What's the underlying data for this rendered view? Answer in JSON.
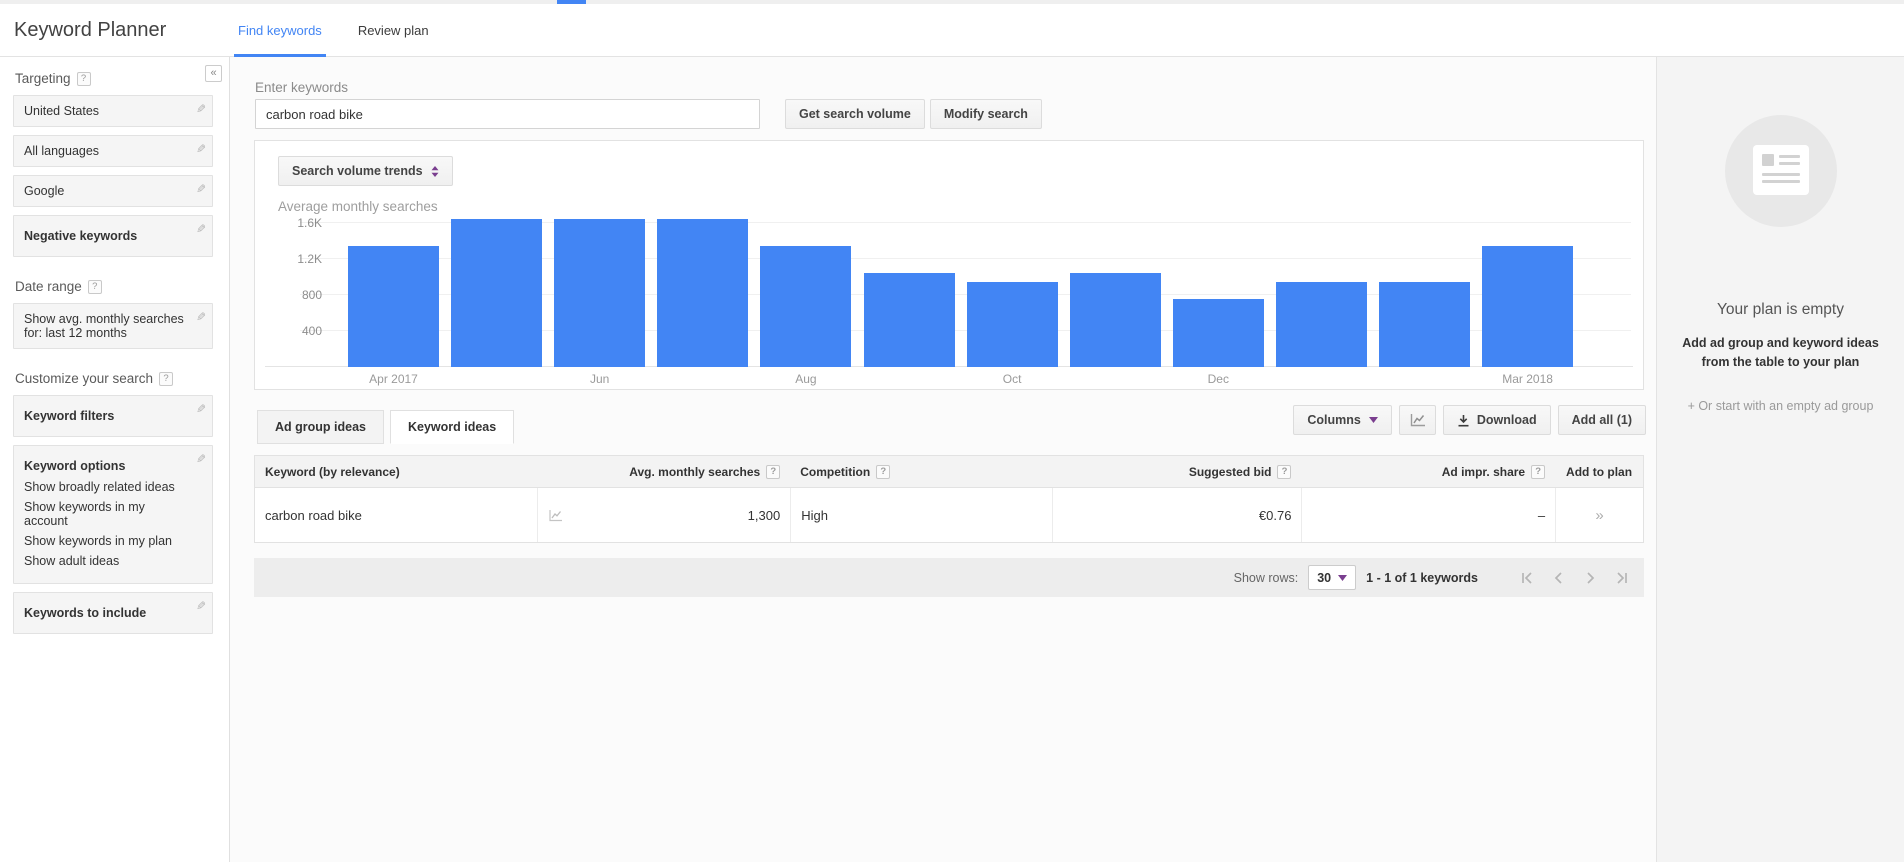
{
  "accent_color": "#4285f4",
  "header": {
    "app_title": "Keyword Planner",
    "tabs": [
      {
        "label": "Find keywords",
        "active": true
      },
      {
        "label": "Review plan",
        "active": false
      }
    ]
  },
  "sidebar": {
    "collapse_glyph": "«",
    "sections": [
      {
        "title": "Targeting",
        "help": true,
        "items": [
          {
            "label": "United States",
            "bold": false
          },
          {
            "label": "All languages",
            "bold": false
          },
          {
            "label": "Google",
            "bold": false
          },
          {
            "label": "Negative keywords",
            "bold": true
          }
        ]
      },
      {
        "title": "Date range",
        "help": true,
        "items": [
          {
            "label": "Show avg. monthly searches for: last 12 months",
            "bold": false
          }
        ]
      },
      {
        "title": "Customize your search",
        "help": true,
        "items": [
          {
            "label": "Keyword filters",
            "bold": true
          },
          {
            "label": "Keyword options",
            "bold": true,
            "sub": [
              "Show broadly related ideas",
              "Show keywords in my account",
              "Show keywords in my plan",
              "Show adult ideas"
            ]
          },
          {
            "label": "Keywords to include",
            "bold": true
          }
        ]
      }
    ]
  },
  "search": {
    "label": "Enter keywords",
    "value": "carbon road bike",
    "get_volume_label": "Get search volume",
    "modify_label": "Modify search"
  },
  "chart_data": {
    "type": "bar",
    "title": "Average monthly searches",
    "control_label": "Search volume trends",
    "categories": [
      "Apr 2017",
      "May 2017",
      "Jun 2017",
      "Jul 2017",
      "Aug 2017",
      "Sep 2017",
      "Oct 2017",
      "Nov 2017",
      "Dec 2017",
      "Jan 2018",
      "Feb 2018",
      "Mar 2018"
    ],
    "values": [
      1350,
      1650,
      1650,
      1650,
      1350,
      1050,
      950,
      1050,
      760,
      950,
      950,
      1350
    ],
    "x_tick_labels": {
      "0": "Apr 2017",
      "2": "Jun",
      "4": "Aug",
      "6": "Oct",
      "8": "Dec",
      "11": "Mar 2018"
    },
    "y_ticks": [
      {
        "value": 400,
        "label": "400"
      },
      {
        "value": 800,
        "label": "800"
      },
      {
        "value": 1200,
        "label": "1.2K"
      },
      {
        "value": 1600,
        "label": "1.6K"
      }
    ],
    "ylim": [
      0,
      1650
    ],
    "bar_color": "#4285f4",
    "grid": "horizontal",
    "legend": "none"
  },
  "results": {
    "tabs": [
      {
        "label": "Ad group ideas",
        "active": false
      },
      {
        "label": "Keyword ideas",
        "active": true
      }
    ],
    "toolbar": {
      "columns_label": "Columns",
      "download_label": "Download",
      "add_all_label": "Add all (1)"
    },
    "table": {
      "headers": [
        {
          "label": "Keyword (by relevance)",
          "help": false
        },
        {
          "label": "Avg. monthly searches",
          "help": true
        },
        {
          "label": "Competition",
          "help": true
        },
        {
          "label": "Suggested bid",
          "help": true
        },
        {
          "label": "Ad impr. share",
          "help": true
        },
        {
          "label": "Add to plan",
          "help": false
        }
      ],
      "row": {
        "keyword": "carbon road bike",
        "avg_monthly_searches": "1,300",
        "competition": "High",
        "suggested_bid": "€0.76",
        "ad_impr_share": "–",
        "add_glyph": "»"
      }
    },
    "pagination": {
      "show_rows_label": "Show rows:",
      "rows_value": "30",
      "range_text": "1 - 1 of 1 keywords"
    }
  },
  "plan_panel": {
    "title": "Your plan is empty",
    "message": "Add ad group and keyword ideas from the table to your plan",
    "alt_action": "+ Or start with an empty ad group"
  }
}
